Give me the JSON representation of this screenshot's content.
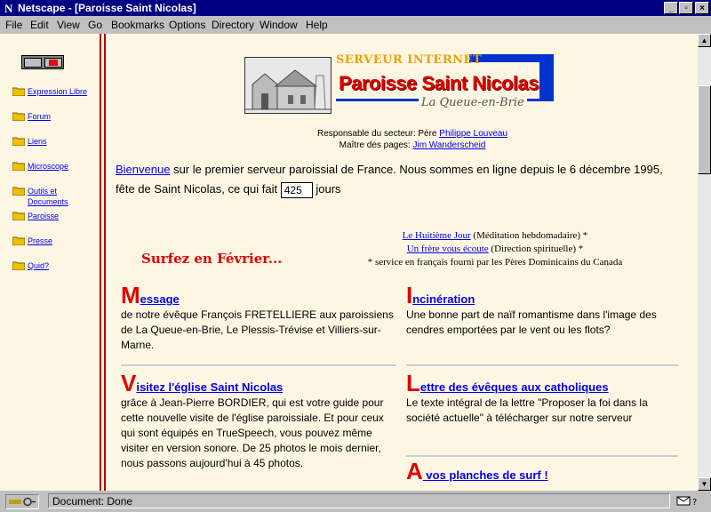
{
  "window": {
    "title": "Netscape - [Paroisse Saint Nicolas]"
  },
  "menu": [
    "File",
    "Edit",
    "View",
    "Go",
    "Bookmarks",
    "Options",
    "Directory",
    "Window",
    "Help"
  ],
  "sidebar": {
    "items": [
      {
        "label": "Expression Libre"
      },
      {
        "label": "Forum"
      },
      {
        "label": "Liens"
      },
      {
        "label": "Microscope"
      },
      {
        "label": "Outils et Documents"
      },
      {
        "label": "Paroisse"
      },
      {
        "label": "Presse"
      },
      {
        "label": "Quid?"
      }
    ]
  },
  "logo": {
    "server": "SERVEUR INTERNET",
    "title": "Paroisse Saint Nicolas",
    "subtitle": "La Queue-en-Brie"
  },
  "responsables": {
    "sector_label": "Responsable du secteur: Père",
    "sector_name": "Philippe Louveau",
    "pages_label": "Maître des pages:",
    "pages_name": "Jim Wanderscheid"
  },
  "intro": {
    "link": "Bienvenue",
    "text1": "sur le premier serveur paroissial de France. Nous sommes en ligne depuis le 6 décembre 1995, fête de Saint Nicolas, ce qui fait",
    "counter": "425",
    "text2": "jours"
  },
  "surfez": "Surfez en Février...",
  "specials": {
    "link1": "Le Huitième Jour",
    "desc1": "(Méditation hebdomadaire) *",
    "link2": "Un frère vous écoute",
    "desc2": "(Direction spirituelle) *",
    "note": "* service en français fourni par les Pères Dominicains du Canada"
  },
  "articles": [
    {
      "cap": "M",
      "link": "essage",
      "text": "de notre évêque François FRETELLIERE aux paroissiens de La Queue-en-Brie, Le Plessis-Trévise et Villiers-sur-Marne."
    },
    {
      "cap": "I",
      "link": "ncinération",
      "text": "Une bonne part de naïf romantisme dans l'image des cendres emportées par le vent ou les flots?"
    },
    {
      "cap": "V",
      "link": "isitez l'église Saint Nicolas",
      "text": "grâce à Jean-Pierre BORDIER, qui est votre guide pour cette nouvelle visite de l'église paroissiale. Et pour ceux qui sont équipés en TrueSpeech, vous pouvez même visiter en version sonore. De 25 photos le mois dernier, nous passons aujourd'hui à 45 photos."
    },
    {
      "cap": "L",
      "link": "ettre des évêques aux catholiques",
      "text": "Le texte intégral de la lettre \"Proposer la foi dans la société actuelle\" à télécharger sur notre serveur"
    },
    {
      "cap": "A",
      "link": " vos planches de surf !",
      "text": ""
    }
  ],
  "status": {
    "text": "Document: Done"
  }
}
